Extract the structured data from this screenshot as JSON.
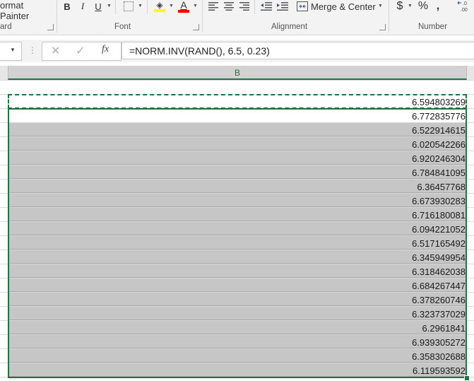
{
  "ribbon": {
    "clipboard": {
      "format_painter_label": "ormat Painter",
      "group_label": "ard"
    },
    "font": {
      "group_label": "Font",
      "bold": "B",
      "italic": "I",
      "underline": "U",
      "font_color_letter": "A"
    },
    "alignment": {
      "group_label": "Alignment",
      "merge_center_label": "Merge & Center"
    },
    "number": {
      "group_label": "Number",
      "currency_symbol": "$",
      "percent_symbol": "%",
      "comma_symbol": ","
    },
    "colors": {
      "fill_highlight": "#ffff00",
      "font_red": "#ff0000",
      "accent": "#217346"
    }
  },
  "formula_bar": {
    "fx_label": "fx",
    "formula": "=NORM.INV(RAND(), 6.5, 0.23)"
  },
  "sheet": {
    "column_header": "B",
    "values": [
      "6.594803269",
      "6.772835776",
      "6.522914615",
      "6.020542266",
      "6.920246304",
      "6.784841095",
      "6.36457768",
      "6.673930283",
      "6.716180081",
      "6.094221052",
      "6.517165492",
      "6.345949954",
      "6.318462038",
      "6.684267447",
      "6.378260746",
      "6.323737029",
      "6.2961841",
      "6.939305272",
      "6.358302688",
      "6.119593592"
    ]
  }
}
